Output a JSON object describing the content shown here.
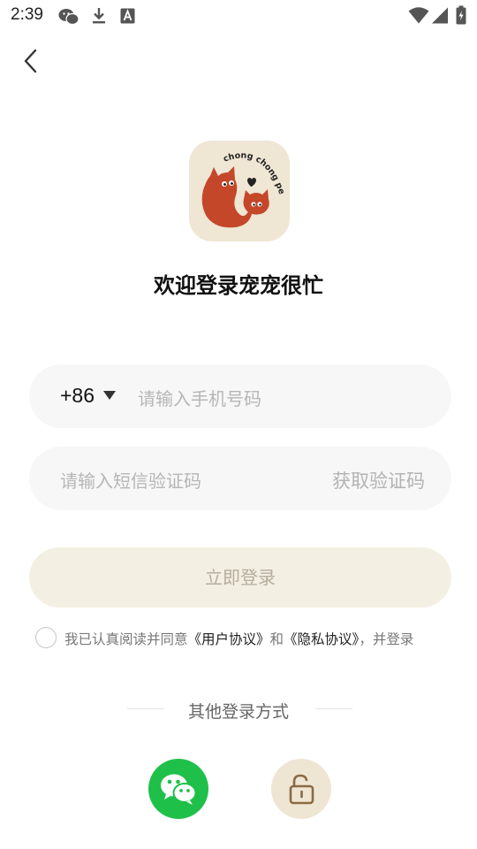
{
  "status_bar": {
    "time": "2:39",
    "left_icons": [
      "wechat-icon",
      "download-icon",
      "text-a-icon"
    ],
    "right_icons": [
      "wifi-icon",
      "cellular-signal-icon",
      "battery-charging-icon"
    ]
  },
  "nav": {
    "back_icon": "chevron-left-icon"
  },
  "logo": {
    "text": "chong chong pet",
    "bg_color": "#efe6d4",
    "cat_color": "#c4472a"
  },
  "welcome_title": "欢迎登录宠宠很忙",
  "phone": {
    "country_code": "+86",
    "country_dropdown_icon": "caret-down-icon",
    "placeholder": "请输入手机号码"
  },
  "sms": {
    "placeholder": "请输入短信验证码",
    "get_code_label": "获取验证码"
  },
  "login_button_label": "立即登录",
  "agreement": {
    "prefix": "我已认真阅读并同意",
    "user_agreement": "《用户协议》",
    "and": "和",
    "privacy_policy": "《隐私协议》",
    "suffix": "，并登录"
  },
  "other_login": {
    "title": "其他登录方式",
    "options": [
      {
        "icon": "wechat-icon",
        "color": "#1fc04a"
      },
      {
        "icon": "unlock-icon",
        "color": "#efe5d3"
      }
    ]
  }
}
